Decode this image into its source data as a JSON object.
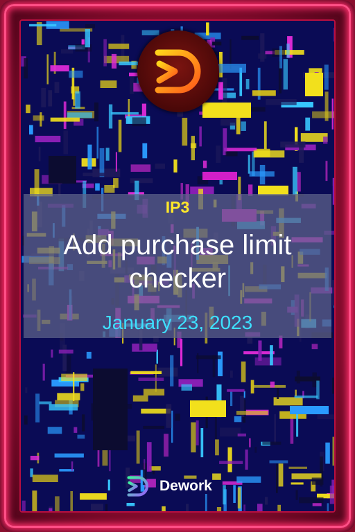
{
  "tag": "IP3",
  "title": "Add purchase limit checker",
  "date": "January 23, 2023",
  "brand": {
    "name": "Dework",
    "logo_icon": "dework-d-logo-icon"
  },
  "colors": {
    "frame": "#c8164a",
    "background": "#0a0b55",
    "tag": "#ffe82a",
    "date": "#3ee0ff",
    "title": "#ffffff"
  }
}
